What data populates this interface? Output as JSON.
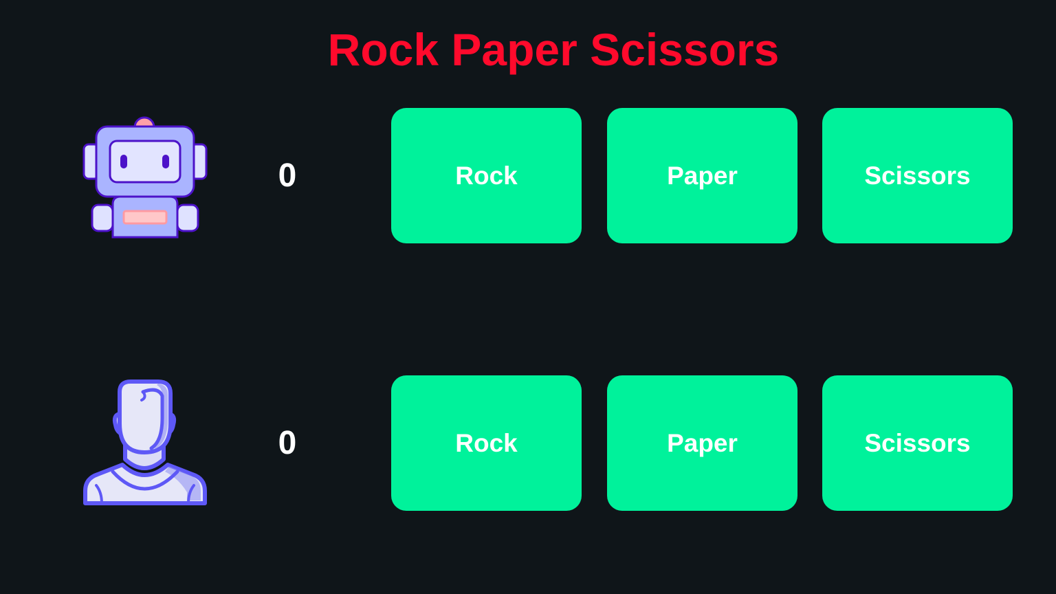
{
  "title": "Rock Paper Scissors",
  "colors": {
    "background": "#0f1519",
    "title": "#ff0a2c",
    "button": "#00f29b",
    "button_text": "#ffffff",
    "score_text": "#ffffff"
  },
  "computer": {
    "avatar_icon": "robot-icon",
    "score": "0",
    "choices": [
      "Rock",
      "Paper",
      "Scissors"
    ]
  },
  "player": {
    "avatar_icon": "user-icon",
    "score": "0",
    "choices": [
      "Rock",
      "Paper",
      "Scissors"
    ]
  }
}
